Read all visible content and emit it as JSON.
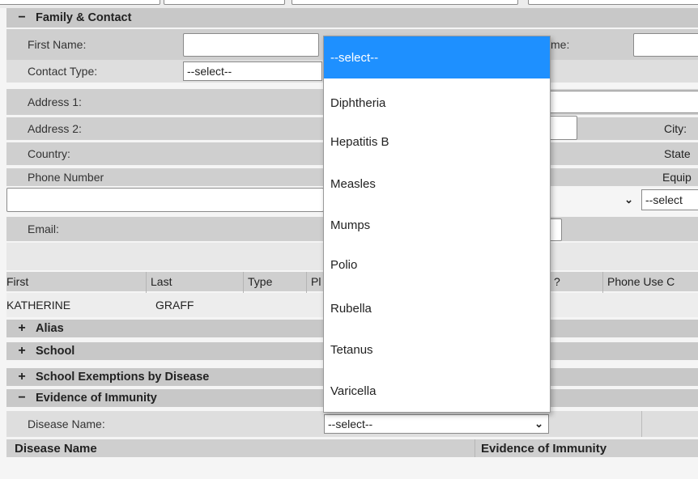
{
  "sections": {
    "family_contact": {
      "symbol": "−",
      "title": "Family & Contact"
    },
    "alias": {
      "symbol": "+",
      "title": "Alias"
    },
    "school": {
      "symbol": "+",
      "title": "School"
    },
    "exemptions": {
      "symbol": "+",
      "title": "School Exemptions by Disease"
    },
    "immunity": {
      "symbol": "−",
      "title": "Evidence of Immunity"
    }
  },
  "form": {
    "first_name_label": "First Name:",
    "last_name_label_partial": "me:",
    "contact_type_label": "Contact Type:",
    "contact_type_value": "--select--",
    "address1_label": "Address 1:",
    "address2_label": "Address 2:",
    "city_label": "City:",
    "country_label": "Country:",
    "state_label_partial": "State",
    "phone_label": "Phone Number",
    "equip_label_partial": "Equip",
    "phone_select_partial": "--select",
    "email_label": "Email:"
  },
  "contacts_table": {
    "headers": [
      "First",
      "Last",
      "Type",
      "Pl",
      "?",
      "Phone Use C"
    ],
    "rows": [
      [
        "KATHERINE",
        "GRAFF",
        "",
        "",
        "",
        ""
      ]
    ]
  },
  "immunity": {
    "disease_label": "Disease Name:",
    "disease_select_value": "--select--",
    "headers": [
      "Disease Name",
      "Evidence of Immunity"
    ]
  },
  "dropdown": {
    "options": [
      "--select--",
      "Diphtheria",
      "Hepatitis B",
      "Measles",
      "Mumps",
      "Polio",
      "Rubella",
      "Tetanus",
      "Varicella"
    ],
    "selected_index": 0
  },
  "colors": {
    "highlight": "#1e90ff",
    "section_bar": "#c8c8c8",
    "row_grey": "#cfcfcf"
  }
}
